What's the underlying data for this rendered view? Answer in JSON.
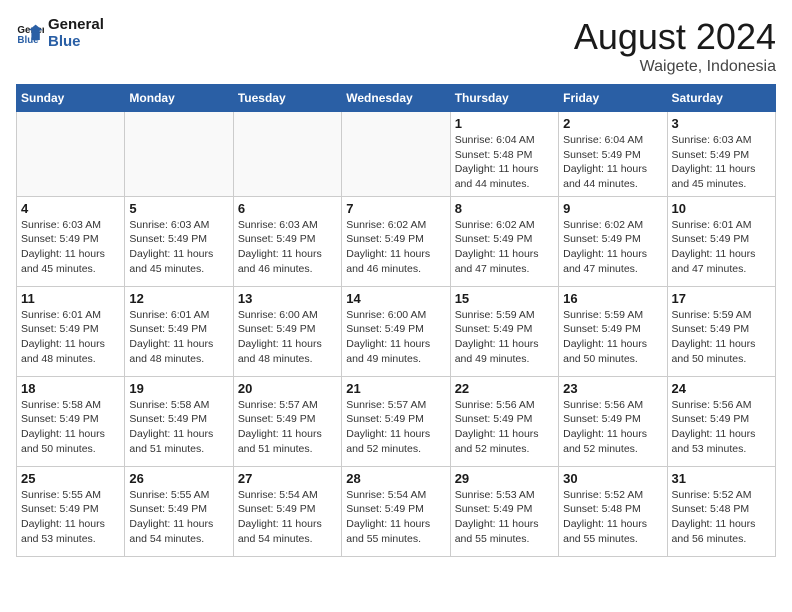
{
  "header": {
    "logo_line1": "General",
    "logo_line2": "Blue",
    "month_year": "August 2024",
    "location": "Waigete, Indonesia"
  },
  "days_of_week": [
    "Sunday",
    "Monday",
    "Tuesday",
    "Wednesday",
    "Thursday",
    "Friday",
    "Saturday"
  ],
  "weeks": [
    [
      {
        "day": "",
        "detail": ""
      },
      {
        "day": "",
        "detail": ""
      },
      {
        "day": "",
        "detail": ""
      },
      {
        "day": "",
        "detail": ""
      },
      {
        "day": "1",
        "detail": "Sunrise: 6:04 AM\nSunset: 5:48 PM\nDaylight: 11 hours\nand 44 minutes."
      },
      {
        "day": "2",
        "detail": "Sunrise: 6:04 AM\nSunset: 5:49 PM\nDaylight: 11 hours\nand 44 minutes."
      },
      {
        "day": "3",
        "detail": "Sunrise: 6:03 AM\nSunset: 5:49 PM\nDaylight: 11 hours\nand 45 minutes."
      }
    ],
    [
      {
        "day": "4",
        "detail": "Sunrise: 6:03 AM\nSunset: 5:49 PM\nDaylight: 11 hours\nand 45 minutes."
      },
      {
        "day": "5",
        "detail": "Sunrise: 6:03 AM\nSunset: 5:49 PM\nDaylight: 11 hours\nand 45 minutes."
      },
      {
        "day": "6",
        "detail": "Sunrise: 6:03 AM\nSunset: 5:49 PM\nDaylight: 11 hours\nand 46 minutes."
      },
      {
        "day": "7",
        "detail": "Sunrise: 6:02 AM\nSunset: 5:49 PM\nDaylight: 11 hours\nand 46 minutes."
      },
      {
        "day": "8",
        "detail": "Sunrise: 6:02 AM\nSunset: 5:49 PM\nDaylight: 11 hours\nand 47 minutes."
      },
      {
        "day": "9",
        "detail": "Sunrise: 6:02 AM\nSunset: 5:49 PM\nDaylight: 11 hours\nand 47 minutes."
      },
      {
        "day": "10",
        "detail": "Sunrise: 6:01 AM\nSunset: 5:49 PM\nDaylight: 11 hours\nand 47 minutes."
      }
    ],
    [
      {
        "day": "11",
        "detail": "Sunrise: 6:01 AM\nSunset: 5:49 PM\nDaylight: 11 hours\nand 48 minutes."
      },
      {
        "day": "12",
        "detail": "Sunrise: 6:01 AM\nSunset: 5:49 PM\nDaylight: 11 hours\nand 48 minutes."
      },
      {
        "day": "13",
        "detail": "Sunrise: 6:00 AM\nSunset: 5:49 PM\nDaylight: 11 hours\nand 48 minutes."
      },
      {
        "day": "14",
        "detail": "Sunrise: 6:00 AM\nSunset: 5:49 PM\nDaylight: 11 hours\nand 49 minutes."
      },
      {
        "day": "15",
        "detail": "Sunrise: 5:59 AM\nSunset: 5:49 PM\nDaylight: 11 hours\nand 49 minutes."
      },
      {
        "day": "16",
        "detail": "Sunrise: 5:59 AM\nSunset: 5:49 PM\nDaylight: 11 hours\nand 50 minutes."
      },
      {
        "day": "17",
        "detail": "Sunrise: 5:59 AM\nSunset: 5:49 PM\nDaylight: 11 hours\nand 50 minutes."
      }
    ],
    [
      {
        "day": "18",
        "detail": "Sunrise: 5:58 AM\nSunset: 5:49 PM\nDaylight: 11 hours\nand 50 minutes."
      },
      {
        "day": "19",
        "detail": "Sunrise: 5:58 AM\nSunset: 5:49 PM\nDaylight: 11 hours\nand 51 minutes."
      },
      {
        "day": "20",
        "detail": "Sunrise: 5:57 AM\nSunset: 5:49 PM\nDaylight: 11 hours\nand 51 minutes."
      },
      {
        "day": "21",
        "detail": "Sunrise: 5:57 AM\nSunset: 5:49 PM\nDaylight: 11 hours\nand 52 minutes."
      },
      {
        "day": "22",
        "detail": "Sunrise: 5:56 AM\nSunset: 5:49 PM\nDaylight: 11 hours\nand 52 minutes."
      },
      {
        "day": "23",
        "detail": "Sunrise: 5:56 AM\nSunset: 5:49 PM\nDaylight: 11 hours\nand 52 minutes."
      },
      {
        "day": "24",
        "detail": "Sunrise: 5:56 AM\nSunset: 5:49 PM\nDaylight: 11 hours\nand 53 minutes."
      }
    ],
    [
      {
        "day": "25",
        "detail": "Sunrise: 5:55 AM\nSunset: 5:49 PM\nDaylight: 11 hours\nand 53 minutes."
      },
      {
        "day": "26",
        "detail": "Sunrise: 5:55 AM\nSunset: 5:49 PM\nDaylight: 11 hours\nand 54 minutes."
      },
      {
        "day": "27",
        "detail": "Sunrise: 5:54 AM\nSunset: 5:49 PM\nDaylight: 11 hours\nand 54 minutes."
      },
      {
        "day": "28",
        "detail": "Sunrise: 5:54 AM\nSunset: 5:49 PM\nDaylight: 11 hours\nand 55 minutes."
      },
      {
        "day": "29",
        "detail": "Sunrise: 5:53 AM\nSunset: 5:49 PM\nDaylight: 11 hours\nand 55 minutes."
      },
      {
        "day": "30",
        "detail": "Sunrise: 5:52 AM\nSunset: 5:48 PM\nDaylight: 11 hours\nand 55 minutes."
      },
      {
        "day": "31",
        "detail": "Sunrise: 5:52 AM\nSunset: 5:48 PM\nDaylight: 11 hours\nand 56 minutes."
      }
    ]
  ]
}
